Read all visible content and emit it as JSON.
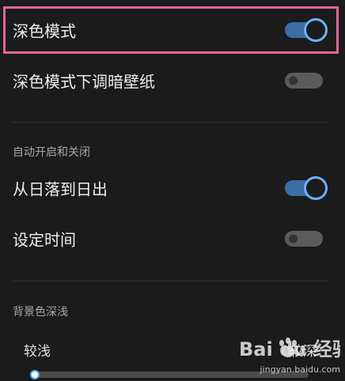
{
  "settings": {
    "dark_mode": {
      "label": "深色模式",
      "enabled": true
    },
    "dim_wallpaper": {
      "label": "深色模式下调暗壁纸",
      "enabled": false
    },
    "auto_section": {
      "header": "自动开启和关闭",
      "sunset_to_sunrise": {
        "label": "从日落到日出",
        "enabled": true
      },
      "set_time": {
        "label": "设定时间",
        "enabled": false
      }
    },
    "depth_section": {
      "header": "背景色深浅",
      "slider": {
        "min_label": "较浅",
        "max_label": "较深",
        "value": 0
      }
    }
  },
  "watermark": {
    "brand": "Bai du 经验",
    "url": "jingyan.baidu.com"
  },
  "colors": {
    "background": "#1b1b1c",
    "toggle_on_track": "#3a6ea5",
    "toggle_on_ring": "#6ab3ff",
    "toggle_off_track": "#5b5b5d",
    "highlight_border": "#e0649a",
    "slider_accent": "#4fb0ff"
  }
}
